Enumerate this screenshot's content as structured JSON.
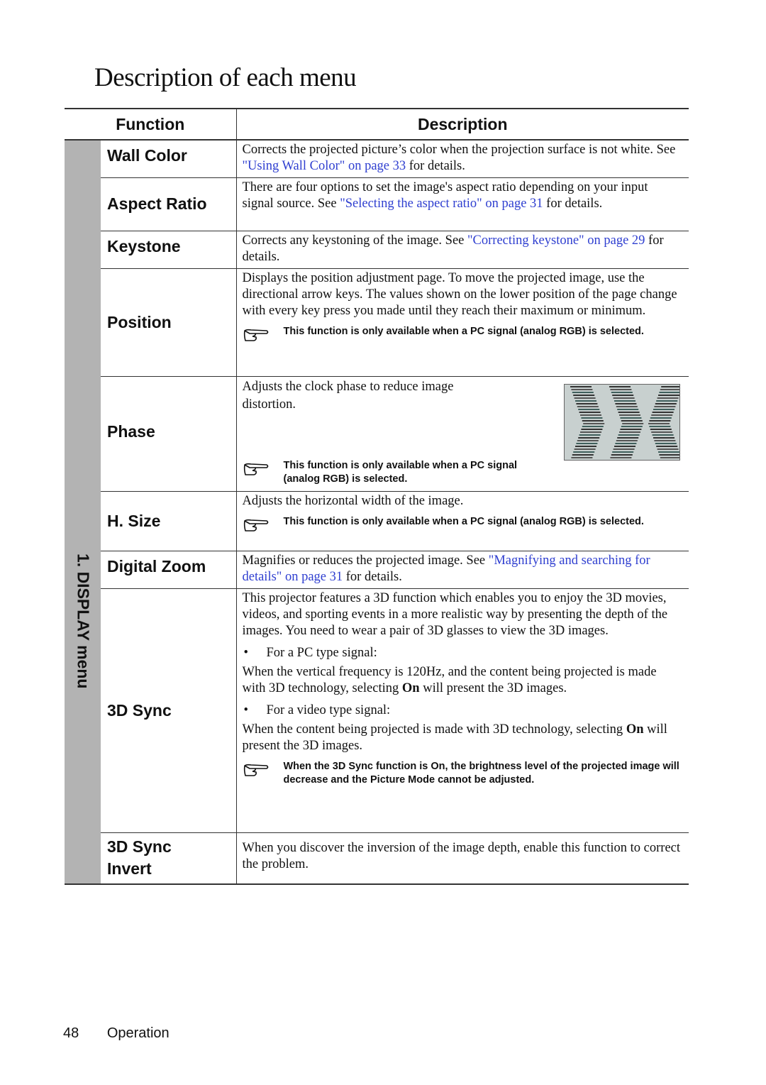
{
  "page": {
    "title": "Description of each menu",
    "footer": {
      "page_number": "48",
      "section": "Operation"
    }
  },
  "table": {
    "headers": {
      "function": "Function",
      "description": "Description"
    },
    "group_label": "1. DISPLAY menu",
    "colors": {
      "link": "#2f3fd0",
      "group_band": "#b3b3b3"
    },
    "rows": [
      {
        "function": "Wall Color",
        "text_before": "Corrects the projected picture’s color when the projection surface is not white. See ",
        "link": "\"Using Wall Color\" on page 33",
        "text_after": " for details."
      },
      {
        "function": "Aspect Ratio",
        "text_before": "There are four options to set the image's aspect ratio depending on your input signal source. See ",
        "link": "\"Selecting the aspect ratio\" on page 31",
        "text_after": " for details."
      },
      {
        "function": "Keystone",
        "text_before": "Corrects any keystoning of the image. See ",
        "link": "\"Correcting keystone\" on page 29",
        "text_after": " for details."
      },
      {
        "function": "Position",
        "text": "Displays the position adjustment page. To move the projected image, use the directional arrow keys. The values shown on the lower position of the page change with every key press you made until they reach their maximum or minimum.",
        "note": "This function is only available when a PC signal (analog RGB) is selected.",
        "note_icon": "pointing-hand-icon"
      },
      {
        "function": "Phase",
        "text": "Adjusts the clock phase to reduce image distortion.",
        "image": "phase-distortion-illustration",
        "note": "This function is only available when a PC signal (analog RGB) is selected.",
        "note_icon": "pointing-hand-icon"
      },
      {
        "function": "H. Size",
        "text": "Adjusts the horizontal width of the image.",
        "note": "This function is only available when a PC signal (analog RGB) is selected.",
        "note_icon": "pointing-hand-icon"
      },
      {
        "function": "Digital Zoom",
        "text_before": "Magnifies or reduces the projected image. See ",
        "link": "\"Magnifying and searching for details\" on page 31",
        "text_after": " for details."
      },
      {
        "function": "3D Sync",
        "intro": "This projector features a 3D function which enables you to enjoy the 3D movies, videos, and sporting events in a more realistic way by presenting the depth of the images. You need to wear a pair of 3D glasses to view the 3D images.",
        "bullets": [
          {
            "label": "For a PC type signal:",
            "text_before": "When the vertical frequency is 120Hz, and the content being projected is made with 3D technology, selecting ",
            "emphasis": "On",
            "text_after": " will present the 3D images."
          },
          {
            "label": "For a video type signal:",
            "text_before": "When the content being projected is made with 3D technology, selecting ",
            "emphasis": "On",
            "text_after": " will present the 3D images."
          }
        ],
        "bullet_char": "•",
        "note": "When the 3D Sync function is On, the brightness level of the projected image will decrease and the Picture Mode cannot be adjusted.",
        "note_icon": "pointing-hand-icon"
      },
      {
        "function": "3D Sync Invert",
        "text": "When you discover the inversion of the image depth, enable this function to correct the problem."
      }
    ]
  }
}
